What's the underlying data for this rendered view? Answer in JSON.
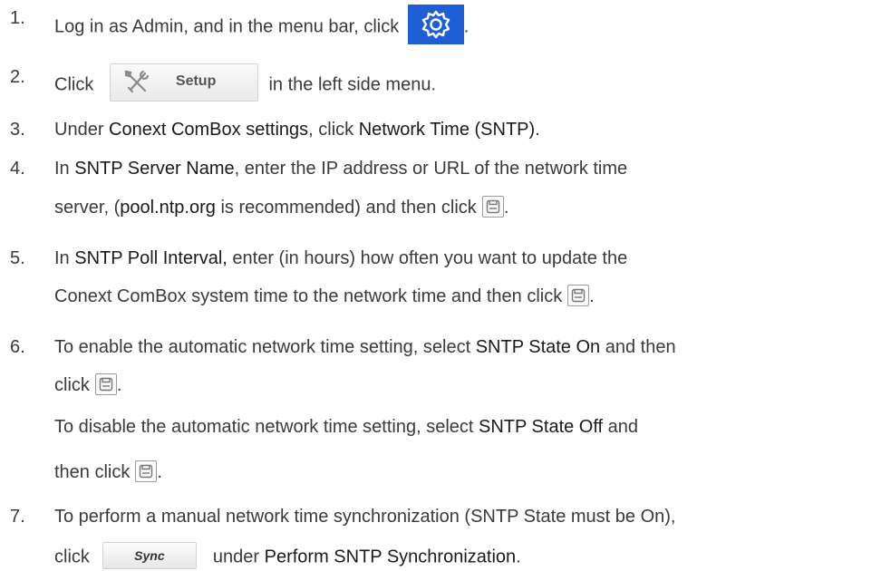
{
  "steps": [
    {
      "num": "1.",
      "line1": {
        "text": "Log in as Admin, and in the menu bar, click",
        "icon": "gear-icon",
        "after": "."
      }
    },
    {
      "num": "2.",
      "line1": {
        "before": "Click",
        "button": "Setup",
        "after": "in the left side menu."
      }
    },
    {
      "num": "3.",
      "line1": {
        "p1": "Under ",
        "b1": "Conext ComBox settings",
        "p2": ", click ",
        "b2": "Network Time (SNTP)",
        "p3": "."
      }
    },
    {
      "num": "4.",
      "line1": {
        "p1": "In ",
        "b1": "SNTP Server Name",
        "p2": ", enter the IP address or URL of the network time"
      },
      "line2": {
        "p1": "server, (",
        "b1": "pool.ntp.org",
        "p2": " is recommended) and then click",
        "after": "."
      }
    },
    {
      "num": "5.",
      "line1": {
        "p1": "In ",
        "b1": "SNTP Poll Interval,",
        "p2": " enter (in hours) how often you want to update the"
      },
      "line2": {
        "p1": "Conext ComBox system time to the network time and then click",
        "after": "."
      }
    },
    {
      "num": "6.",
      "line1": {
        "p1": "To enable the automatic network time setting, select ",
        "b1": "SNTP State On",
        "p2": " and then"
      },
      "line2": {
        "p1": "click",
        "after": "."
      },
      "line3": {
        "p1": "To disable the automatic network time setting, select ",
        "b1": "SNTP State Off",
        "p2": " and"
      },
      "line4": {
        "p1": "then click",
        "after": "."
      }
    },
    {
      "num": "7.",
      "line1": {
        "p1": "To perform a manual network time synchronization (SNTP State must be On),"
      },
      "line2": {
        "p1": "click",
        "button": "Sync",
        "p2": "under ",
        "b1": "Perform SNTP Synchronization",
        "p3": "."
      }
    }
  ],
  "icons": {
    "gear": "gear-icon",
    "setup": "wrench-screwdriver-icon",
    "save": "save-icon"
  },
  "colors": {
    "gear_bg": "#1e5fd6",
    "text": "#3a3a3a"
  }
}
